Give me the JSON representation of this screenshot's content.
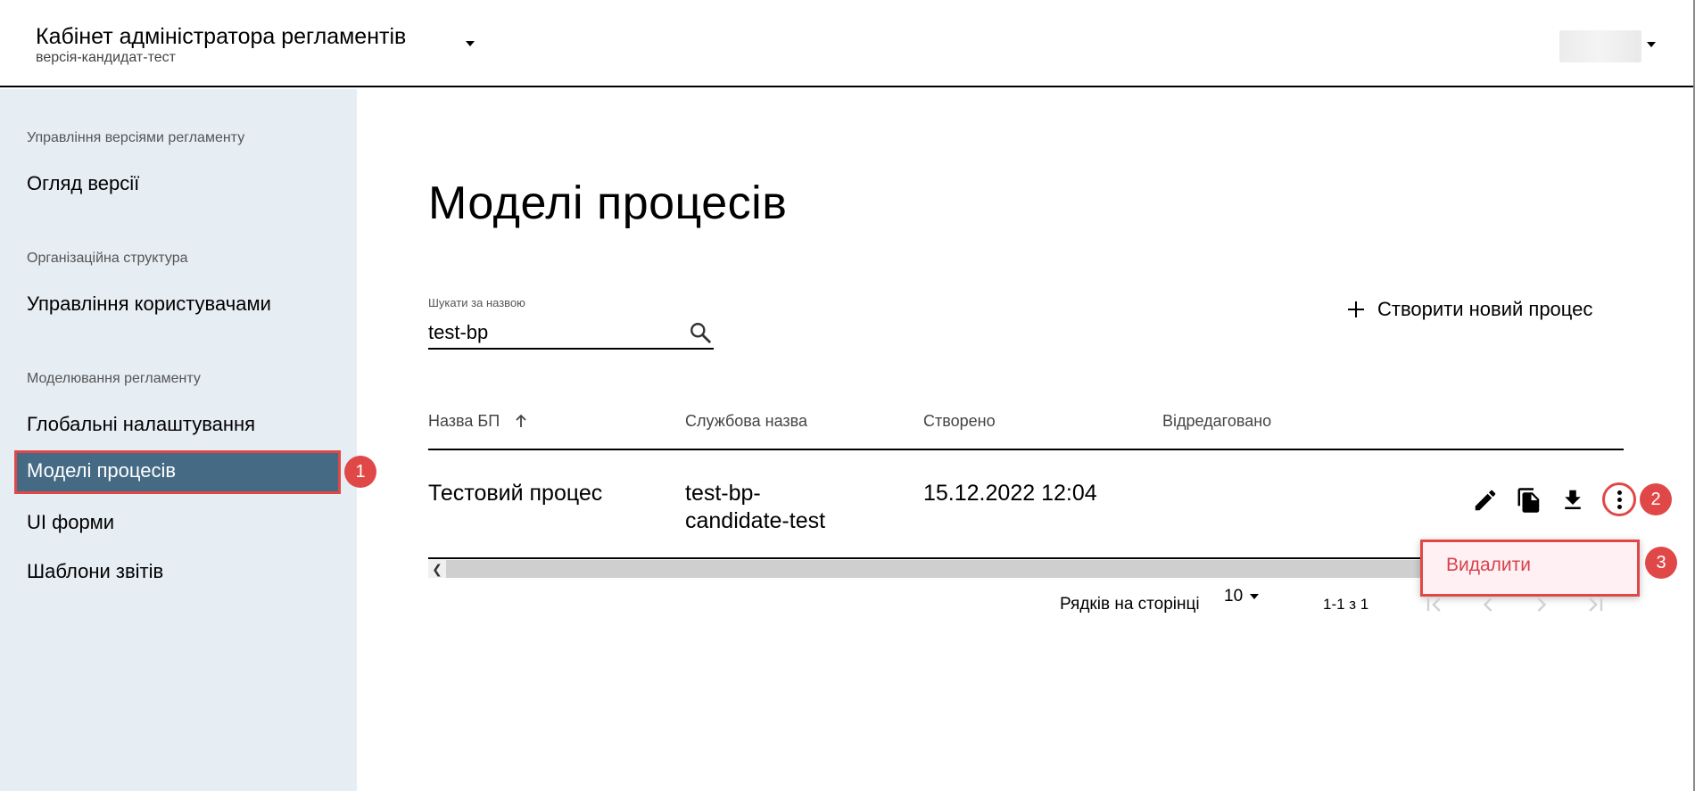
{
  "header": {
    "app_title": "Кабінет адміністратора регламентів",
    "version": "версія-кандидат-тест"
  },
  "sidebar": {
    "sections": [
      {
        "title": "Управління версіями регламенту",
        "items": [
          "Огляд версії"
        ]
      },
      {
        "title": "Організаційна структура",
        "items": [
          "Управління користувачами"
        ]
      },
      {
        "title": "Моделювання регламенту",
        "items": [
          "Глобальні налаштування",
          "Моделі процесів",
          "UI форми",
          "Шаблони звітів"
        ]
      }
    ],
    "active_item": "Моделі процесів"
  },
  "main": {
    "title": "Моделі процесів",
    "search": {
      "label": "Шукати за назвою",
      "value": "test-bp"
    },
    "create_button": "Створити новий процес",
    "table": {
      "columns": [
        "Назва БП",
        "Службова назва",
        "Створено",
        "Відредаговано"
      ],
      "sort_column": "Назва БП",
      "sort_direction": "ascending",
      "rows": [
        {
          "name": "Тестовий процес",
          "service_name_line1": "test-bp-",
          "service_name_line2": "candidate-test",
          "created": "15.12.2022 12:04",
          "edited": ""
        }
      ]
    },
    "row_menu": {
      "items": [
        "Видалити"
      ]
    },
    "pagination": {
      "rows_per_page_label": "Рядків на сторінці",
      "rows_per_page": "10",
      "range": "1-1 з 1"
    }
  },
  "annotations": [
    "1",
    "2",
    "3"
  ],
  "colors": {
    "active_bg": "#456a84",
    "sidebar_bg": "#e6edf3",
    "highlight": "#e04848",
    "danger_text": "#d8414d"
  }
}
